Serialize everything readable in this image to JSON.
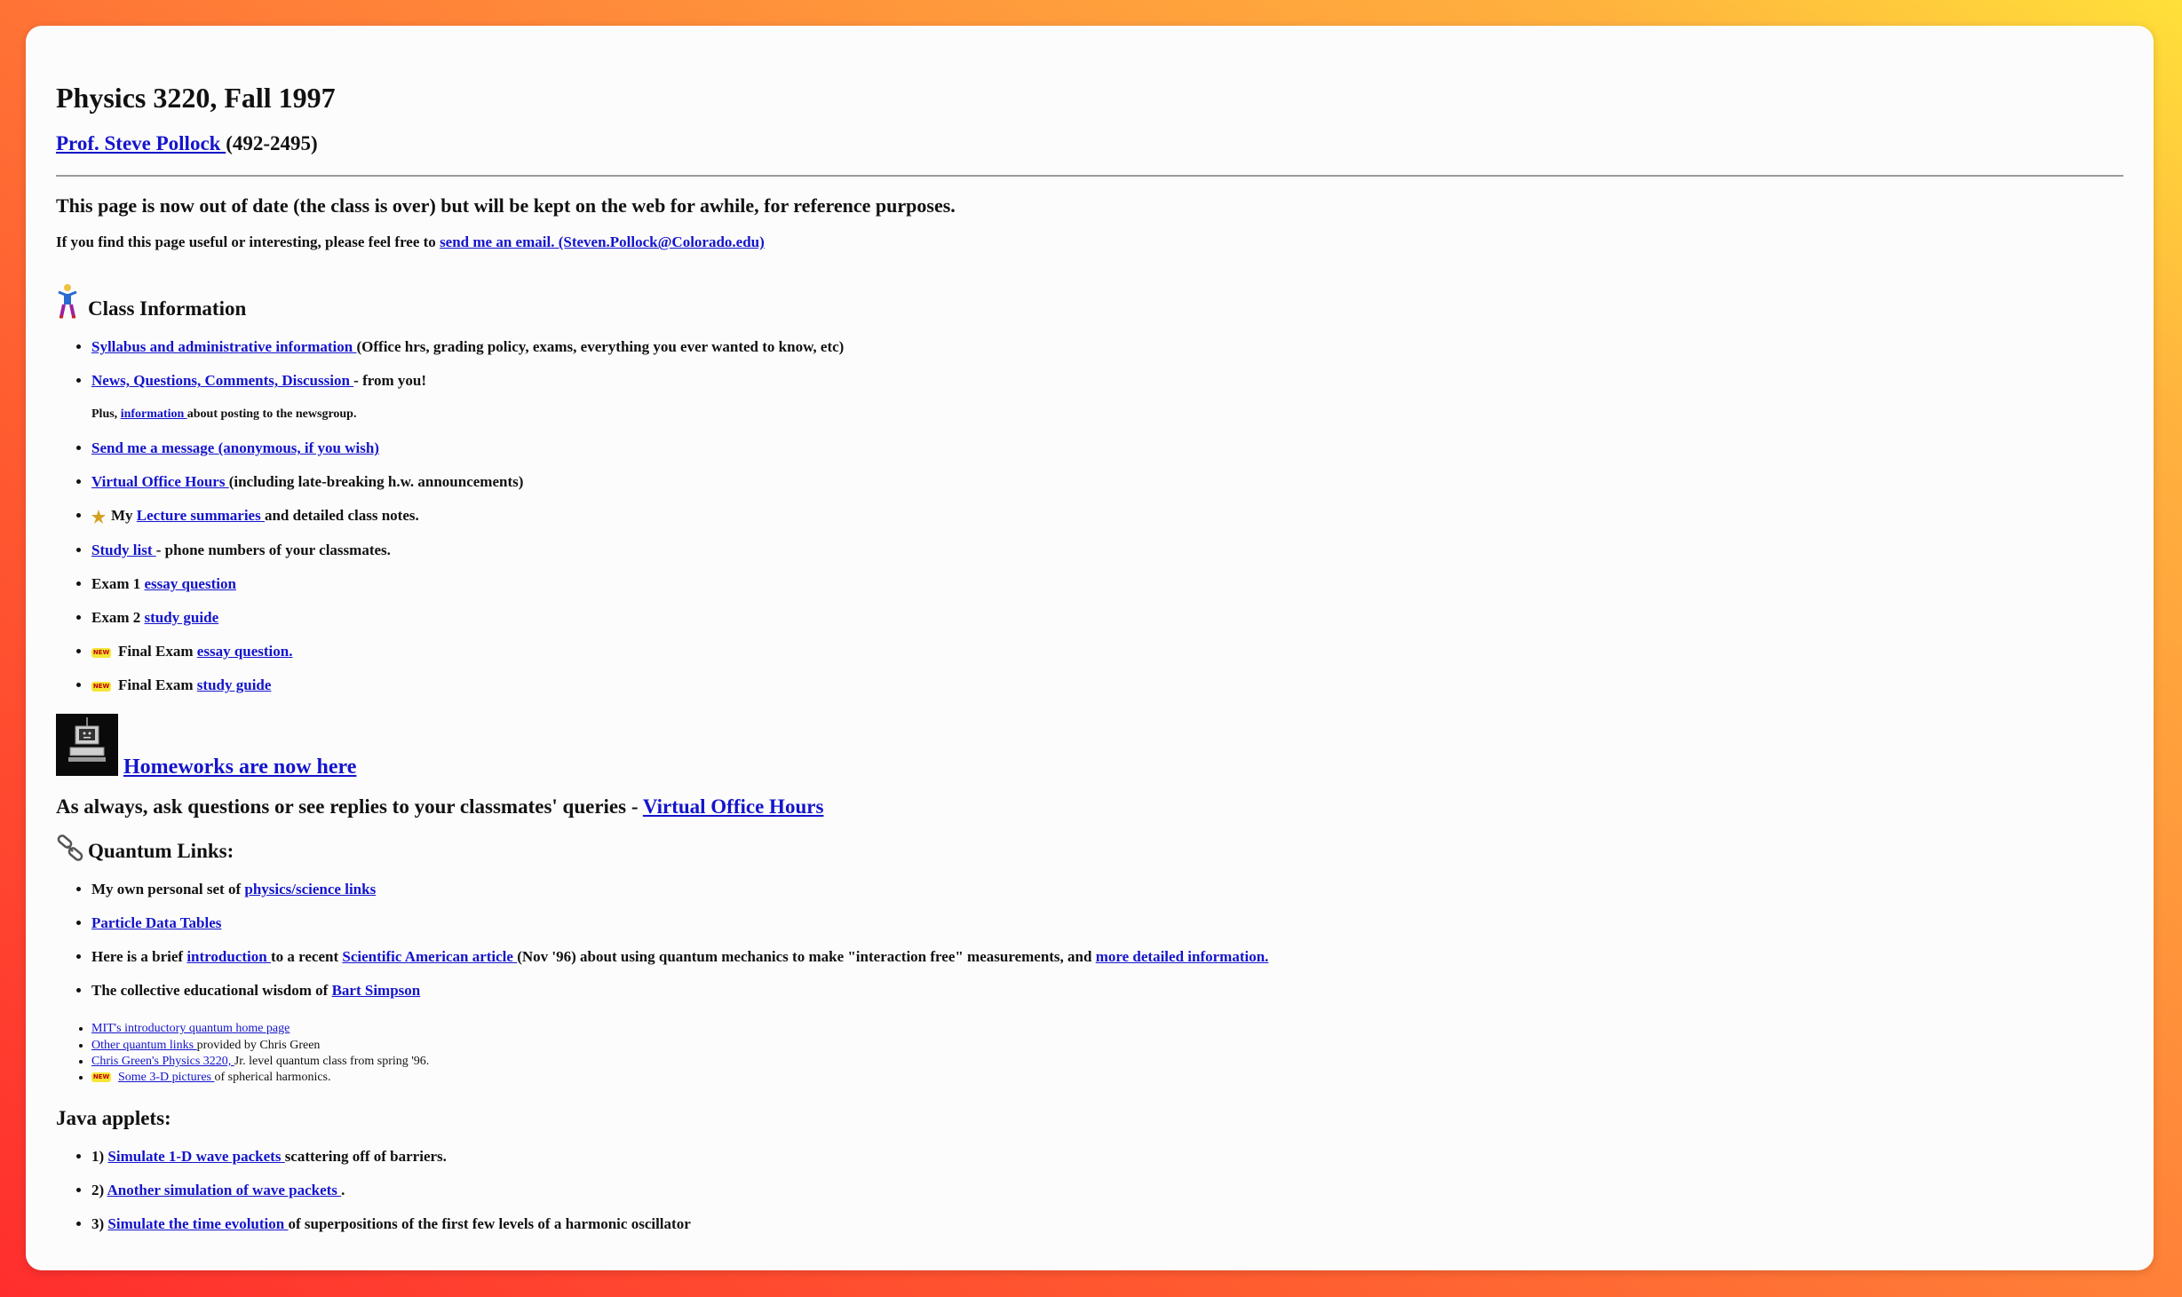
{
  "header": {
    "title": "Physics 3220, Fall 1997",
    "prof_link": "Prof. Steve Pollock ",
    "prof_phone": "(492-2495)"
  },
  "notice": "This page is now out of date (the class is over) but will be kept on the web for awhile, for reference purposes.",
  "feedback": {
    "prefix": "If you find this page useful or interesting, please feel free to ",
    "link": "send me an email. (Steven.Pollock@Colorado.edu)"
  },
  "class_info": {
    "heading": "Class Information",
    "items": {
      "syllabus": {
        "link": "Syllabus and administrative information ",
        "suffix": "(Office hrs, grading policy, exams, everything you ever wanted to know, etc)"
      },
      "news": {
        "link": "News, Questions, Comments, Discussion ",
        "suffix": "- from you!"
      },
      "plus": {
        "prefix": "Plus, ",
        "link": "information ",
        "suffix": "about posting to the newsgroup."
      },
      "message": {
        "link": "Send me a message (anonymous, if you wish)"
      },
      "office": {
        "link": "Virtual Office Hours ",
        "suffix": "(including late-breaking h.w. announcements)"
      },
      "lecture": {
        "prefix": "My ",
        "link": "Lecture summaries ",
        "suffix": "and detailed class notes."
      },
      "study": {
        "link": "Study list ",
        "suffix": "- phone numbers of your classmates."
      },
      "exam1": {
        "prefix": "Exam 1 ",
        "link": "essay question"
      },
      "exam2": {
        "prefix": "Exam 2 ",
        "link": "study guide"
      },
      "final_essay": {
        "prefix": "Final Exam ",
        "link": "essay question."
      },
      "final_study": {
        "prefix": "Final Exam ",
        "link": "study guide"
      }
    }
  },
  "homework": {
    "link": "Homeworks are now here"
  },
  "ask": {
    "prefix": "As always, ask questions or see replies to your classmates' queries - ",
    "link": "Virtual Office Hours"
  },
  "quantum": {
    "heading": "Quantum Links:",
    "personal": {
      "prefix": "My own personal set of ",
      "link": "physics/science links"
    },
    "particle": {
      "link": "Particle Data Tables"
    },
    "brief": {
      "prefix": "Here is a brief ",
      "link1": "introduction ",
      "mid1": "to a recent ",
      "link2": "Scientific American article ",
      "mid2": "(Nov '96) about using quantum mechanics to make \"interaction free\" measurements, and ",
      "link3": "more detailed information."
    },
    "bart": {
      "prefix": "The collective educational wisdom of ",
      "link": "Bart Simpson"
    },
    "small": {
      "mit": {
        "link": "MIT's introductory quantum home page"
      },
      "other": {
        "link": "Other quantum links ",
        "suffix": "provided by Chris Green"
      },
      "chris": {
        "link": "Chris Green's Physics 3220, ",
        "suffix": "Jr. level quantum class from spring '96."
      },
      "pictures": {
        "link": "Some 3-D pictures ",
        "suffix": "of spherical harmonics."
      }
    }
  },
  "java": {
    "heading": "Java applets:",
    "a1": {
      "prefix": "1) ",
      "link": "Simulate 1-D wave packets ",
      "suffix": "scattering off of barriers."
    },
    "a2": {
      "prefix": "2) ",
      "link": "Another simulation of wave packets ",
      "suffix": "."
    },
    "a3": {
      "prefix": "3) ",
      "link": "Simulate the time evolution ",
      "suffix": "of superpositions of the first few levels of a harmonic oscillator"
    }
  },
  "badges": {
    "new": "NEW"
  }
}
